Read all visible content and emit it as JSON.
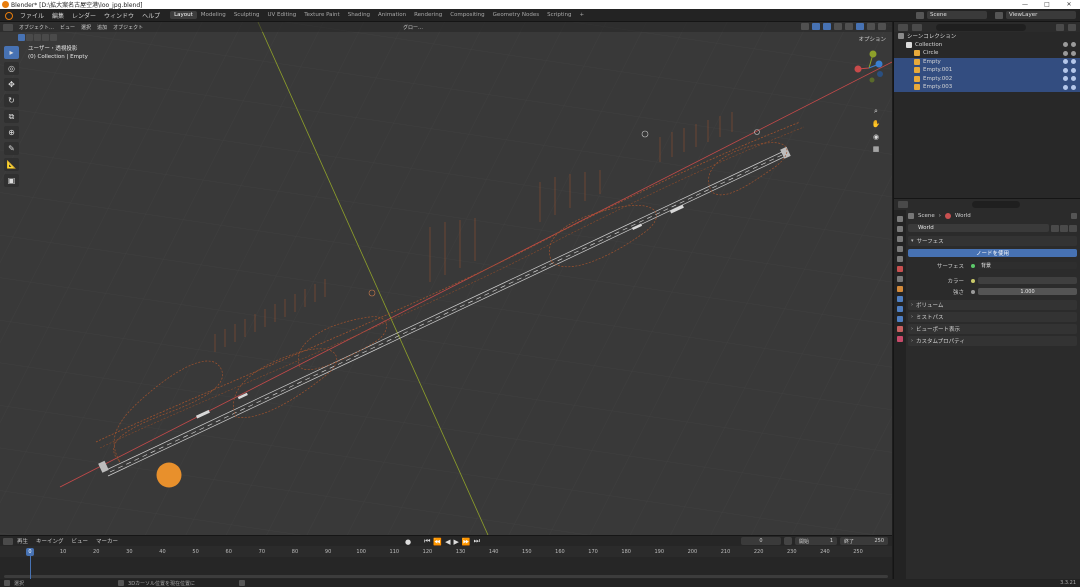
{
  "window": {
    "title": "Blender* [D:\\拡大案名古屋空港\\loo_jpg.blend]",
    "controls": [
      "—",
      "□",
      "✕"
    ]
  },
  "menubar": {
    "menus": [
      "ファイル",
      "編集",
      "レンダー",
      "ウィンドウ",
      "ヘルプ"
    ],
    "workspaces": [
      "Layout",
      "Modeling",
      "Sculpting",
      "UV Editing",
      "Texture Paint",
      "Shading",
      "Animation",
      "Rendering",
      "Compositing",
      "Geometry Nodes",
      "Scripting"
    ],
    "active_workspace": "Layout",
    "add_tab": "+",
    "scene": "Scene",
    "view_layer": "ViewLayer"
  },
  "viewport": {
    "mode": "オブジェクト…",
    "menus": [
      "ビュー",
      "選択",
      "追加",
      "オブジェクト"
    ],
    "transform_orientation": "グロー…",
    "info_line1": "ユーザー・透視投影",
    "info_line2": "(0) Collection | Empty",
    "options_label": "オプション",
    "axis_x_label": "X",
    "axis_y_label": "Y",
    "axis_z_label": "Z",
    "colors": {
      "background": "#393939",
      "runway_lines": "#cfcfcf",
      "taxiway_lines": "#a0522d",
      "x_axis": "#c84a4a",
      "y_axis": "#8ea02a",
      "sun_object": "#e8902c"
    }
  },
  "toolbar": {
    "tools": [
      "select-box-tool",
      "cursor-tool",
      "move-tool",
      "rotate-tool",
      "scale-tool",
      "transform-tool",
      "annotate-tool",
      "measure-tool",
      "add-cube-tool"
    ]
  },
  "timeline": {
    "menus": [
      "再生",
      "キーイング",
      "ビュー",
      "マーカー"
    ],
    "current_frame": "0",
    "start_label": "開始",
    "start_value": "1",
    "end_label": "終了",
    "end_value": "250",
    "playhead_label": "0",
    "ruler": [
      "10",
      "20",
      "30",
      "40",
      "50",
      "60",
      "70",
      "80",
      "90",
      "100",
      "110",
      "120",
      "130",
      "140",
      "150",
      "160",
      "170",
      "180",
      "190",
      "200",
      "210",
      "220",
      "230",
      "240",
      "250"
    ]
  },
  "statusbar": {
    "select": "選択",
    "hint": "3Dカーソル位置を現在位置に",
    "version": "3.3.21"
  },
  "outliner": {
    "rows": [
      {
        "label": "シーンコレクション",
        "indent": 0,
        "selected": false,
        "color": "#8a8a8a"
      },
      {
        "label": "Collection",
        "indent": 1,
        "selected": false,
        "color": "#dcdcdc"
      },
      {
        "label": "Circle",
        "indent": 2,
        "selected": false,
        "color": "#e8a93a"
      },
      {
        "label": "Empty",
        "indent": 2,
        "selected": true,
        "color": "#e8a93a"
      },
      {
        "label": "Empty.001",
        "indent": 2,
        "selected": true,
        "color": "#e8a93a"
      },
      {
        "label": "Empty.002",
        "indent": 2,
        "selected": true,
        "color": "#e8a93a"
      },
      {
        "label": "Empty.003",
        "indent": 2,
        "selected": true,
        "color": "#e8a93a"
      }
    ]
  },
  "properties": {
    "breadcrumb_scene": "Scene",
    "breadcrumb_world": "World",
    "world_name": "World",
    "surface_panel": "サーフェス",
    "use_nodes_button": "ノードを使用",
    "surface_label": "サーフェス",
    "surface_value": "背景",
    "color_label": "カラー",
    "strength_label": "強さ",
    "strength_value": "1.000",
    "panels": [
      "ボリューム",
      "ミストパス",
      "ビューポート表示",
      "カスタムプロパティ"
    ]
  }
}
